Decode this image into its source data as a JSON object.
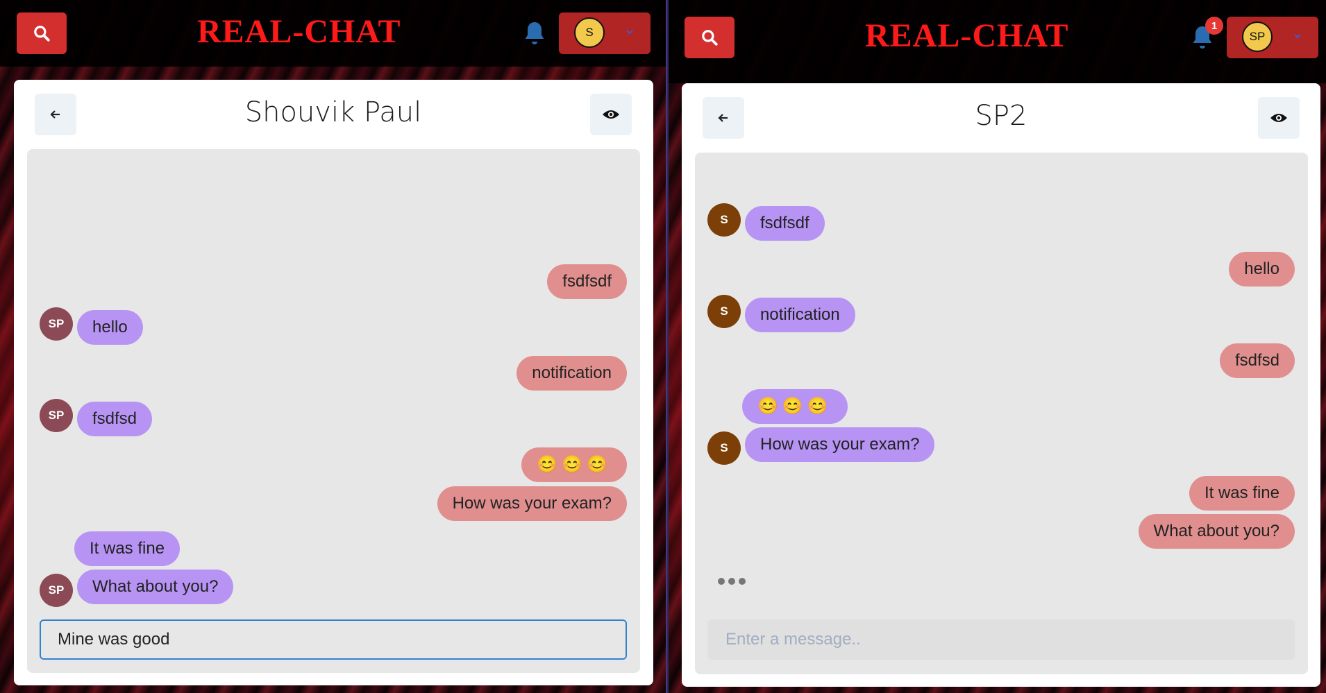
{
  "colors": {
    "brand": "#ff1a1a",
    "search_button": "#d32f2f",
    "profile_button": "#b22525",
    "received_bubble": "#b794f4",
    "sent_bubble": "#e08e8e",
    "input_focus_border": "#3182ce"
  },
  "left": {
    "brand": "REAL-CHAT",
    "profile_initial": "S",
    "chat_title": "Shouvik Paul",
    "messages": [
      {
        "from": "me",
        "text": "fsdfsdf"
      },
      {
        "from": "them",
        "avatar": "SP",
        "text": "hello"
      },
      {
        "from": "me",
        "text": "notification"
      },
      {
        "from": "them",
        "avatar": "SP",
        "text": "fsdfsd"
      },
      {
        "from": "me",
        "text": "😊😊😊"
      },
      {
        "from": "me",
        "text": "How was your exam?"
      },
      {
        "from": "them",
        "text": "It was fine"
      },
      {
        "from": "them",
        "avatar": "SP",
        "text": "What about you?"
      }
    ],
    "input_value": "Mine was good"
  },
  "right": {
    "brand": "REAL-CHAT",
    "notification_count": "1",
    "profile_initial": "SP",
    "chat_title": "SP2",
    "messages": [
      {
        "from": "them",
        "avatar": "S",
        "text": "fsdfsdf"
      },
      {
        "from": "me",
        "text": "hello"
      },
      {
        "from": "them",
        "avatar": "S",
        "text": "notification"
      },
      {
        "from": "me",
        "text": "fsdfsd"
      },
      {
        "from": "them",
        "text": "😊😊😊"
      },
      {
        "from": "them",
        "avatar": "S",
        "text": "How was your exam?"
      },
      {
        "from": "me",
        "text": "It was fine"
      },
      {
        "from": "me",
        "text": "What about you?"
      }
    ],
    "input_placeholder": "Enter a message.."
  }
}
